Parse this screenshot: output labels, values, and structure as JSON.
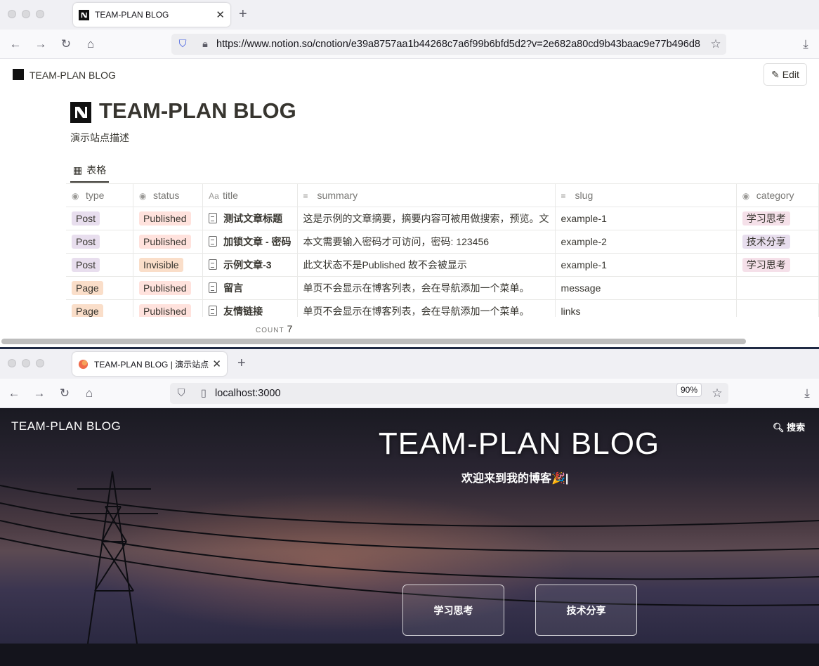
{
  "browser_top": {
    "tab_title": "TEAM-PLAN BLOG",
    "url": "https://www.notion.so/cnotion/e39a8757aa1b44268c7a6f99b6bfd5d2?v=2e682a80cd9b43baac9e77b496d8",
    "new_tab": "+"
  },
  "notion": {
    "workspace_name": "TEAM-PLAN BLOG",
    "edit_label": "Edit",
    "page_title": "TEAM-PLAN BLOG",
    "description": "演示站点描述",
    "view_tab": "表格",
    "columns": [
      "type",
      "status",
      "title",
      "summary",
      "slug",
      "category"
    ],
    "rows": [
      {
        "type": "Post",
        "status": "Published",
        "title": "测试文章标题",
        "summary": "这是示例的文章摘要，摘要内容可被用做搜索，预览。文",
        "slug": "example-1",
        "category": "学习思考"
      },
      {
        "type": "Post",
        "status": "Published",
        "title": "加锁文章 - 密码",
        "summary": "本文需要输入密码才可访问，密码: 123456",
        "slug": "example-2",
        "category": "技术分享"
      },
      {
        "type": "Post",
        "status": "Invisible",
        "title": "示例文章-3",
        "summary": "此文状态不是Published 故不会被显示",
        "slug": "example-1",
        "category": "学习思考"
      },
      {
        "type": "Page",
        "status": "Published",
        "title": "留言",
        "summary": "单页不会显示在博客列表，会在导航添加一个菜单。",
        "slug": "message",
        "category": ""
      },
      {
        "type": "Page",
        "status": "Published",
        "title": "友情链接",
        "summary": "单页不会显示在博客列表，会在导航添加一个菜单。",
        "slug": "links",
        "category": ""
      }
    ],
    "count_label": "COUNT",
    "count_value": "7"
  },
  "browser_bottom": {
    "tab_title": "TEAM-PLAN BLOG | 演示站点描述",
    "url": "localhost:3000",
    "zoom": "90%",
    "new_tab": "+"
  },
  "blog": {
    "site_name": "TEAM-PLAN BLOG",
    "search_label": "搜索",
    "hero_title": "TEAM-PLAN BLOG",
    "hero_subtitle": "欢迎来到我的博客🎉|",
    "categories": [
      "学习思考",
      "技术分享"
    ]
  },
  "colors": {
    "notion_text": "#37352f",
    "post_tag": "#e8deee",
    "page_tag": "#fadec9",
    "published_tag": "#ffe2dd"
  }
}
